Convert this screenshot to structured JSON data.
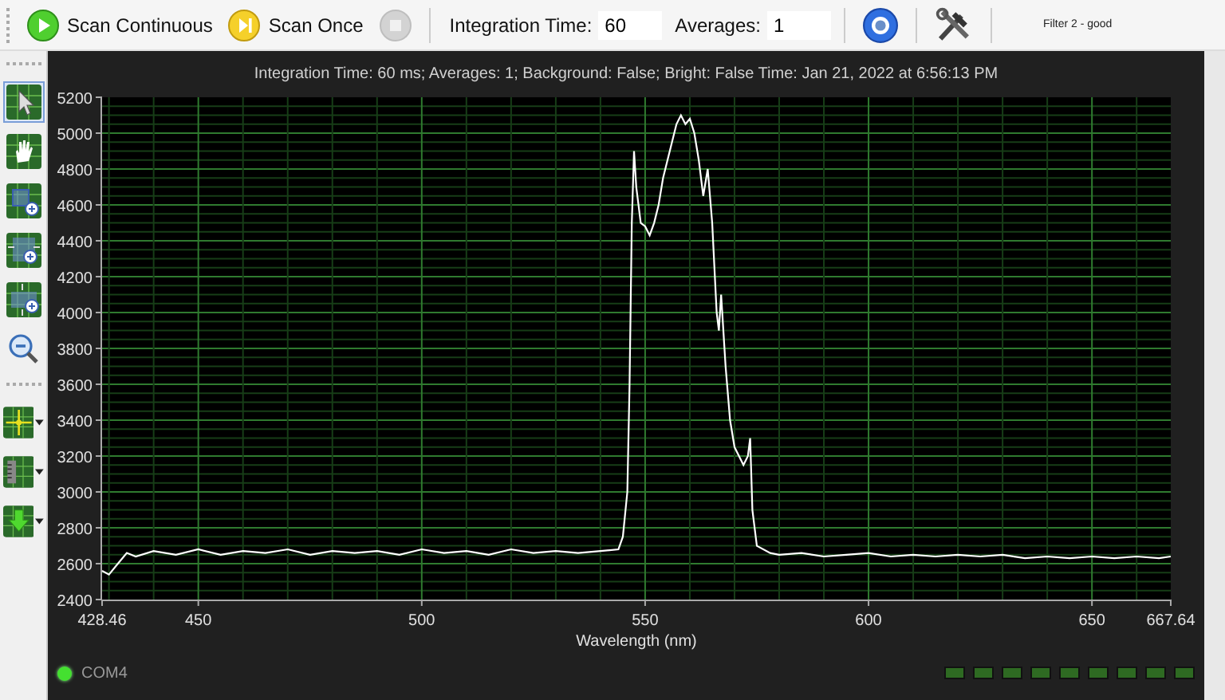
{
  "toolbar": {
    "scan_buttons": [
      {
        "kind": "play",
        "label": "Scan Continuous",
        "disabled": false
      },
      {
        "kind": "step",
        "label": "Scan Once",
        "disabled": false
      },
      {
        "kind": "stop",
        "disabled": true
      }
    ],
    "fields": [
      {
        "label": "Integration Time:",
        "value": "60"
      },
      {
        "label": "Averages:",
        "value": "1"
      }
    ],
    "tool_buttons": [
      {
        "kind": "ring"
      },
      {
        "kind": "tools"
      }
    ],
    "status_text": "Filter 2 - good"
  },
  "side_tools": [
    {
      "kind": "pointer",
      "selected": true,
      "dropdown": false
    },
    {
      "kind": "hand",
      "selected": false,
      "dropdown": false
    },
    {
      "kind": "zoom-box",
      "selected": false,
      "dropdown": false
    },
    {
      "kind": "zoom-x",
      "selected": false,
      "dropdown": false
    },
    {
      "kind": "zoom-y",
      "selected": false,
      "dropdown": false
    },
    {
      "kind": "zoom-out",
      "selected": false,
      "dropdown": false
    },
    {
      "kind": "cursor",
      "selected": false,
      "dropdown": true
    },
    {
      "kind": "scale",
      "selected": false,
      "dropdown": true
    },
    {
      "kind": "download",
      "selected": false,
      "dropdown": true
    }
  ],
  "chart_title": "Integration Time: 60 ms; Averages: 1; Background: False; Bright: False Time: Jan 21, 2022 at 6:56:13 PM",
  "chart_data": {
    "type": "line",
    "grid": true,
    "xlabel": "Wavelength (nm)",
    "xlim": [
      428.46,
      667.64
    ],
    "ylim": [
      2400,
      5200
    ],
    "xticks": [
      428.46,
      450,
      500,
      550,
      600,
      650,
      667.64
    ],
    "yticks": [
      2400,
      2600,
      2800,
      3000,
      3200,
      3400,
      3600,
      3800,
      4000,
      4200,
      4400,
      4600,
      4800,
      5000,
      5200
    ],
    "x": [
      428.46,
      430,
      432,
      434,
      436,
      440,
      445,
      450,
      455,
      460,
      465,
      470,
      475,
      480,
      485,
      490,
      495,
      500,
      505,
      510,
      515,
      520,
      525,
      530,
      535,
      540,
      544,
      545,
      546,
      546.5,
      547,
      547.5,
      548,
      549,
      550,
      551,
      552,
      553,
      554,
      555,
      556,
      557,
      558,
      559,
      560,
      561,
      562,
      563,
      564,
      565,
      566,
      566.5,
      567,
      568,
      569,
      570,
      571,
      572,
      573,
      573.5,
      574,
      575,
      578,
      580,
      585,
      590,
      595,
      600,
      605,
      610,
      615,
      620,
      625,
      630,
      635,
      640,
      645,
      650,
      655,
      660,
      665,
      667.64
    ],
    "series": [
      {
        "color": "#ffffff",
        "values": [
          2560,
          2540,
          2600,
          2660,
          2640,
          2670,
          2650,
          2680,
          2650,
          2670,
          2660,
          2680,
          2650,
          2670,
          2660,
          2670,
          2650,
          2680,
          2660,
          2670,
          2650,
          2680,
          2660,
          2670,
          2660,
          2670,
          2680,
          2750,
          3000,
          3600,
          4500,
          4900,
          4700,
          4500,
          4480,
          4430,
          4500,
          4600,
          4750,
          4850,
          4950,
          5050,
          5100,
          5050,
          5080,
          5000,
          4850,
          4650,
          4800,
          4500,
          4000,
          3900,
          4100,
          3700,
          3400,
          3250,
          3200,
          3150,
          3200,
          3300,
          2900,
          2700,
          2660,
          2650,
          2660,
          2640,
          2650,
          2660,
          2640,
          2650,
          2640,
          2650,
          2640,
          2650,
          2630,
          2640,
          2630,
          2640,
          2630,
          2640,
          2630,
          2640
        ]
      }
    ]
  },
  "status": {
    "port": "COM4",
    "connected": true
  }
}
